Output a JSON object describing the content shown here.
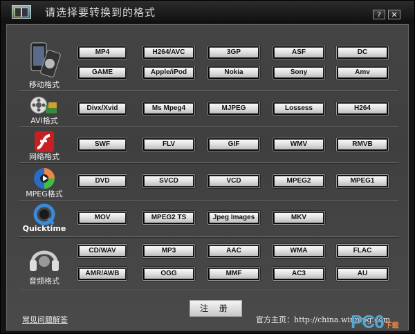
{
  "window": {
    "title": "请选择要转换到的格式",
    "help_label": "?",
    "close_label": "✕"
  },
  "categories": [
    {
      "label": "移动格式",
      "icon": "mobile-phone-icon",
      "formats": [
        "MP4",
        "H264/AVC",
        "3GP",
        "ASF",
        "DC",
        "GAME",
        "Apple/iPod",
        "Nokia",
        "Sony",
        "Amv"
      ]
    },
    {
      "label": "AVI格式",
      "icon": "film-reel-icon",
      "formats": [
        "Divx/Xvid",
        "Ms Mpeg4",
        "MJPEG",
        "Lossess",
        "H264"
      ]
    },
    {
      "label": "网络格式",
      "icon": "flash-icon",
      "formats": [
        "SWF",
        "FLV",
        "GIF",
        "WMV",
        "RMVB"
      ]
    },
    {
      "label": "MPEG格式",
      "icon": "disc-icon",
      "formats": [
        "DVD",
        "SVCD",
        "VCD",
        "MPEG2",
        "MPEG1"
      ]
    },
    {
      "label": "Quicktime",
      "icon": "quicktime-icon",
      "formats": [
        "MOV",
        "MPEG2 TS",
        "Jpeg Images",
        "MKV"
      ]
    },
    {
      "label": "音频格式",
      "icon": "headphones-icon",
      "formats": [
        "CD/WAV",
        "MP3",
        "AAC",
        "WMA",
        "FLAC",
        "AMR/AWB",
        "OGG",
        "MMF",
        "AC3",
        "AU"
      ]
    }
  ],
  "footer": {
    "register_label": "注 册",
    "faq_label": "常见问题解答",
    "home_label": "官方主页：",
    "home_url": "http://china.winmpg.com"
  },
  "watermark": {
    "brand": "PC6",
    "suffix": "下载"
  },
  "colors": {
    "panel": "#444444",
    "button_face": "#dcdcdc",
    "accent": "#55a7d4"
  }
}
